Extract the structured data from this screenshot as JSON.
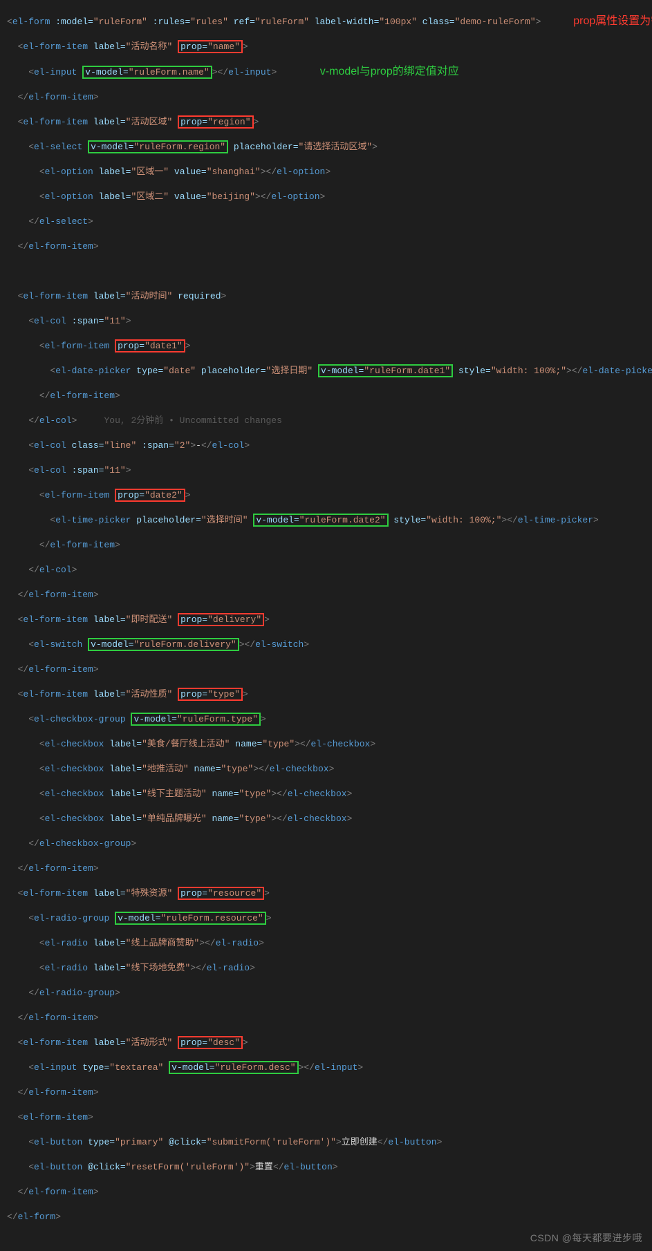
{
  "annotations": {
    "line1_note": "prop属性设置为需检验的字段名",
    "line2_note": "v-model与prop的绑定值对应"
  },
  "blame": "You, 2分钟前 • Uncommitted changes",
  "watermark": "CSDN @每天都要进步哦",
  "form": {
    "open": {
      "tag": "el-form",
      "model": ":model=",
      "model_v": "\"ruleForm\"",
      "rules": ":rules=",
      "rules_v": "\"rules\"",
      "ref": "ref=",
      "ref_v": "\"ruleForm\"",
      "lw": "label-width=",
      "lw_v": "\"100px\"",
      "cls": "class=",
      "cls_v": "\"demo-ruleForm\""
    },
    "item_name": {
      "label_a": "label=",
      "label_v": "\"活动名称\"",
      "prop_a": "prop=",
      "prop_v": "\"name\""
    },
    "input_name": {
      "vm_a": "v-model=",
      "vm_v": "\"ruleForm.name\""
    },
    "item_region": {
      "label_a": "label=",
      "label_v": "\"活动区域\"",
      "prop_a": "prop=",
      "prop_v": "\"region\""
    },
    "select_region": {
      "vm_a": "v-model=",
      "vm_v": "\"ruleForm.region\"",
      "ph_a": "placeholder=",
      "ph_v": "\"请选择活动区域\""
    },
    "opt1": {
      "label_a": "label=",
      "label_v": "\"区域一\"",
      "val_a": "value=",
      "val_v": "\"shanghai\""
    },
    "opt2": {
      "label_a": "label=",
      "label_v": "\"区域二\"",
      "val_a": "value=",
      "val_v": "\"beijing\""
    },
    "item_time": {
      "label_a": "label=",
      "label_v": "\"活动时间\"",
      "req": "required"
    },
    "col11": {
      "span_a": ":span=",
      "span_v": "\"11\""
    },
    "item_date1": {
      "prop_a": "prop=",
      "prop_v": "\"date1\""
    },
    "dp": {
      "type_a": "type=",
      "type_v": "\"date\"",
      "ph_a": "placeholder=",
      "ph_v": "\"选择日期\"",
      "vm_a": "v-model=",
      "vm_v": "\"ruleForm.date1\"",
      "st_a": "style=",
      "st_v": "\"width: 100%;\""
    },
    "col_line": {
      "cls_a": "class=",
      "cls_v": "\"line\"",
      "span_a": ":span=",
      "span_v": "\"2\"",
      "txt": "-"
    },
    "item_date2": {
      "prop_a": "prop=",
      "prop_v": "\"date2\""
    },
    "tp": {
      "ph_a": "placeholder=",
      "ph_v": "\"选择时间\"",
      "vm_a": "v-model=",
      "vm_v": "\"ruleForm.date2\"",
      "st_a": "style=",
      "st_v": "\"width: 100%;\""
    },
    "item_delivery": {
      "label_a": "label=",
      "label_v": "\"即时配送\"",
      "prop_a": "prop=",
      "prop_v": "\"delivery\""
    },
    "switch": {
      "vm_a": "v-model=",
      "vm_v": "\"ruleForm.delivery\""
    },
    "item_type": {
      "label_a": "label=",
      "label_v": "\"活动性质\"",
      "prop_a": "prop=",
      "prop_v": "\"type\""
    },
    "cbg": {
      "vm_a": "v-model=",
      "vm_v": "\"ruleForm.type\""
    },
    "cb1": {
      "label_a": "label=",
      "label_v": "\"美食/餐厅线上活动\"",
      "name_a": "name=",
      "name_v": "\"type\""
    },
    "cb2": {
      "label_a": "label=",
      "label_v": "\"地推活动\"",
      "name_a": "name=",
      "name_v": "\"type\""
    },
    "cb3": {
      "label_a": "label=",
      "label_v": "\"线下主题活动\"",
      "name_a": "name=",
      "name_v": "\"type\""
    },
    "cb4": {
      "label_a": "label=",
      "label_v": "\"单纯品牌曝光\"",
      "name_a": "name=",
      "name_v": "\"type\""
    },
    "item_resource": {
      "label_a": "label=",
      "label_v": "\"特殊资源\"",
      "prop_a": "prop=",
      "prop_v": "\"resource\""
    },
    "rg": {
      "vm_a": "v-model=",
      "vm_v": "\"ruleForm.resource\""
    },
    "r1": {
      "label_a": "label=",
      "label_v": "\"线上品牌商赞助\""
    },
    "r2": {
      "label_a": "label=",
      "label_v": "\"线下场地免费\""
    },
    "item_desc": {
      "label_a": "label=",
      "label_v": "\"活动形式\"",
      "prop_a": "prop=",
      "prop_v": "\"desc\""
    },
    "ta": {
      "type_a": "type=",
      "type_v": "\"textarea\"",
      "vm_a": "v-model=",
      "vm_v": "\"ruleForm.desc\""
    },
    "btn1": {
      "type_a": "type=",
      "type_v": "\"primary\"",
      "click_a": "@click=",
      "click_v": "\"submitForm('ruleForm')\"",
      "txt": "立即创建"
    },
    "btn2": {
      "click_a": "@click=",
      "click_v": "\"resetForm('ruleForm')\"",
      "txt": "重置"
    }
  }
}
